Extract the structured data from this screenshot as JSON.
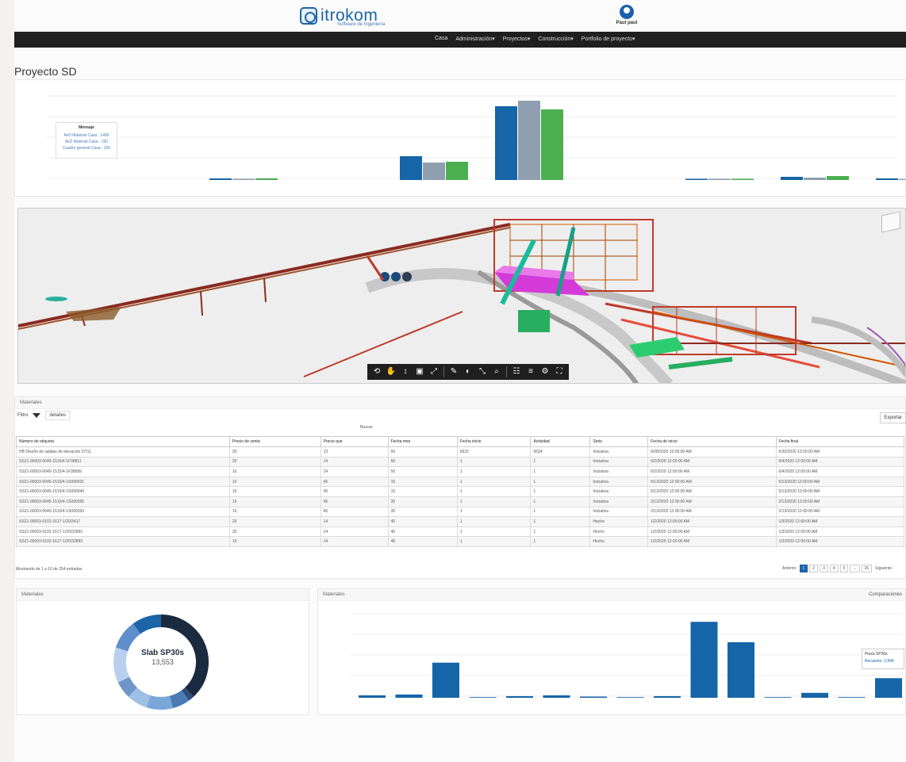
{
  "header": {
    "brand": "itrokom",
    "brand_sub": "Software de Ingeniería",
    "user_name": "Paul paul"
  },
  "nav": [
    "Casa",
    "Administración▾",
    "Proyectos▾",
    "Construcción▾",
    "Portfolio de proyecto▾"
  ],
  "page_title": "Proyecto SD",
  "chart_top": {
    "legend_title": "Mensaje",
    "legend_entries": [
      "AvD Material Casa : 1400",
      "AvD Material Casa : 150",
      "Cuadro general Casa : 150"
    ]
  },
  "viewer": {
    "toolbar_icons": [
      "orbit-icon",
      "pan-icon",
      "zoom-icon",
      "camera-icon",
      "fit-icon",
      "measure-icon",
      "section-icon",
      "explode-icon",
      "search-icon",
      "model-tree-icon",
      "properties-icon",
      "settings-icon",
      "fullscreen-icon"
    ]
  },
  "table": {
    "panel_title": "Materiales",
    "filter_label": "Filtro",
    "filter_chip": "detalles",
    "search_label": "Buscar",
    "export_label": "Exportar",
    "columns": [
      "Número de etiqueta",
      "Precio de venta",
      "Precio que",
      "Fecha mes",
      "Fecha inicio",
      "Actividad",
      "Serie",
      "Fecha de inicio",
      "Fecha final"
    ],
    "rows": [
      [
        "HB Diseño de salidas de elevación 07/11",
        "20",
        "13",
        "50",
        "5632",
        "5634",
        "Iniciativa",
        "6/28/2020 12:00:00 AM",
        "6/30/2020 12:00:00 AM"
      ],
      [
        "SS21-00003-0045-1515/4-1F38811",
        "20",
        "14",
        "50",
        "1",
        "1",
        "Iniciativa",
        "6/2/2020 12:00:00 AM",
        "6/4/2020 12:00:00 AM"
      ],
      [
        "SS21-00003-0045-1515/4-1F38099",
        "10",
        "14",
        "50",
        "1",
        "1",
        "Iniciativa",
        "6/2/2020 12:00:00 AM",
        "6/4/2020 12:00:00 AM"
      ],
      [
        "SS21-00003-0045-1515/4-1S090931",
        "10",
        "45",
        "15",
        "1",
        "1",
        "Iniciativa",
        "5/13/2020 12:00:00 AM",
        "5/13/2020 12:00:00 AM"
      ],
      [
        "SS21-00003-0045-1515/4-1S090940",
        "10",
        "45",
        "15",
        "1",
        "1",
        "Iniciativa",
        "5/13/2020 12:00:00 AM",
        "5/13/2020 12:00:00 AM"
      ],
      [
        "SS21-00003-0045-1515/4-1S090395",
        "10",
        "45",
        "35",
        "1",
        "1",
        "Iniciativa",
        "2/13/2020 12:00:00 AM",
        "2/13/2020 12:00:00 AM"
      ],
      [
        "SS21-00003-0045-1515/4-1S090393",
        "10",
        "45",
        "35",
        "1",
        "1",
        "Iniciativa",
        "2/13/2020 12:00:00 AM",
        "2/13/2020 12:00:00 AM"
      ],
      [
        "SS21-00003-0102-1617-1/20/3417",
        "20",
        "14",
        "40",
        "1",
        "1",
        "Hecho",
        "1/2/2020 12:00:00 AM",
        "1/3/2020 12:00:00 AM"
      ],
      [
        "SS21-00003-0102-1617-1/20/32892",
        "20",
        "14",
        "40",
        "1",
        "1",
        "Hecho",
        "1/2/2020 12:00:00 AM",
        "1/3/2020 12:00:00 AM"
      ],
      [
        "SS21-00003-0102-1617-1/20/32893",
        "10",
        "14",
        "40",
        "1",
        "1",
        "Hecho",
        "1/2/2020 12:00:00 AM",
        "1/3/2020 12:00:00 AM"
      ]
    ],
    "info": "Mostrando de 1 a 10 de 254 entradas",
    "pager": {
      "prev": "Anterior",
      "pages": [
        "1",
        "2",
        "3",
        "4",
        "5",
        "...",
        "26"
      ],
      "next": "Siguiente"
    }
  },
  "donut": {
    "panel_title": "Materiales",
    "center_title": "Slab SP30s",
    "center_value": "13,553"
  },
  "bar2": {
    "panel_title": "Materiales",
    "compare_label": "Comparaciones",
    "tooltip_title": "Pieza SP30s",
    "tooltip_value": "Recuento: 2,844"
  },
  "colors": {
    "blue": "#1565a8",
    "gray": "#8f9fb0",
    "green": "#4caf50",
    "navbar": "#1f1f1f"
  }
}
